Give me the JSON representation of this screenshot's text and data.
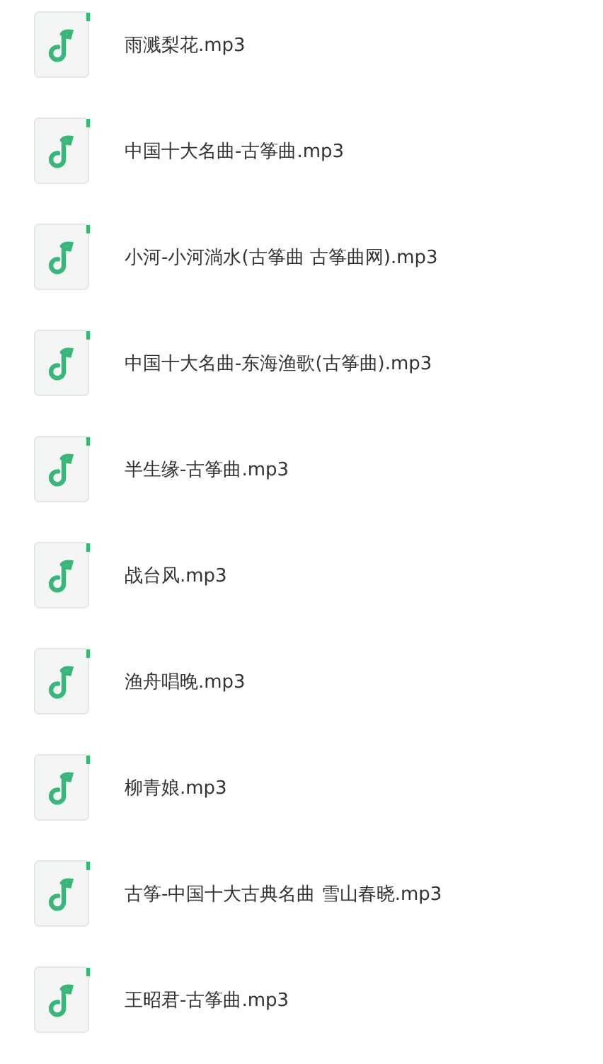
{
  "files": [
    {
      "name": "雨溅梨花.mp3"
    },
    {
      "name": "中国十大名曲-古筝曲.mp3"
    },
    {
      "name": "小河-小河淌水(古筝曲 古筝曲网).mp3"
    },
    {
      "name": "中国十大名曲-东海渔歌(古筝曲).mp3"
    },
    {
      "name": "半生缘-古筝曲.mp3"
    },
    {
      "name": "战台风.mp3"
    },
    {
      "name": "渔舟唱晚.mp3"
    },
    {
      "name": "柳青娘.mp3"
    },
    {
      "name": "古筝-中国十大古典名曲 雪山春晓.mp3"
    },
    {
      "name": "王昭君-古筝曲.mp3"
    }
  ]
}
